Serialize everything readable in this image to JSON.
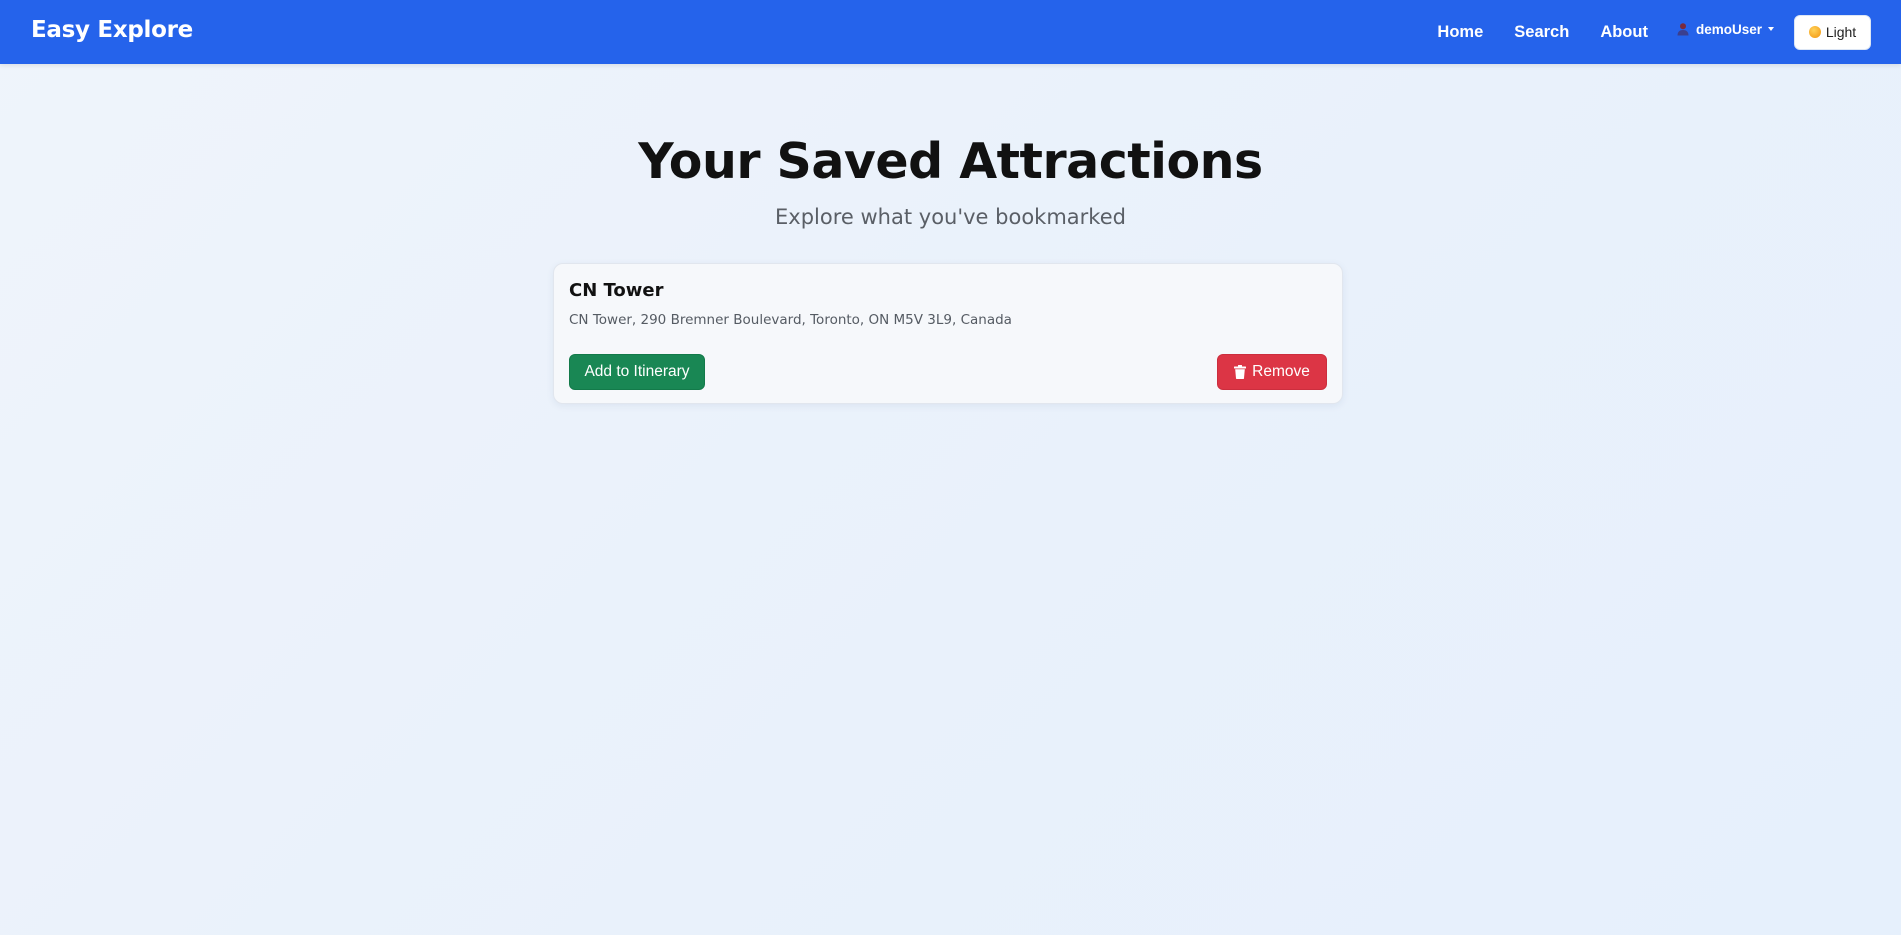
{
  "navbar": {
    "brand": "Easy Explore",
    "links": [
      "Home",
      "Search",
      "About"
    ],
    "user": {
      "name": "demoUser",
      "icon": "user-icon"
    },
    "theme_toggle": {
      "label": "Light",
      "icon": "sun-icon"
    }
  },
  "header": {
    "title": "Your Saved Attractions",
    "subtitle": "Explore what you've bookmarked"
  },
  "saved_attractions": [
    {
      "name": "CN Tower",
      "address": "CN Tower, 290 Bremner Boulevard, Toronto, ON M5V 3L9, Canada",
      "add_label": "Add to Itinerary",
      "remove_label": "Remove",
      "remove_icon": "trash-icon"
    }
  ],
  "colors": {
    "navbar": "#2563eb",
    "add_button": "#198754",
    "remove_button": "#dc3545"
  }
}
